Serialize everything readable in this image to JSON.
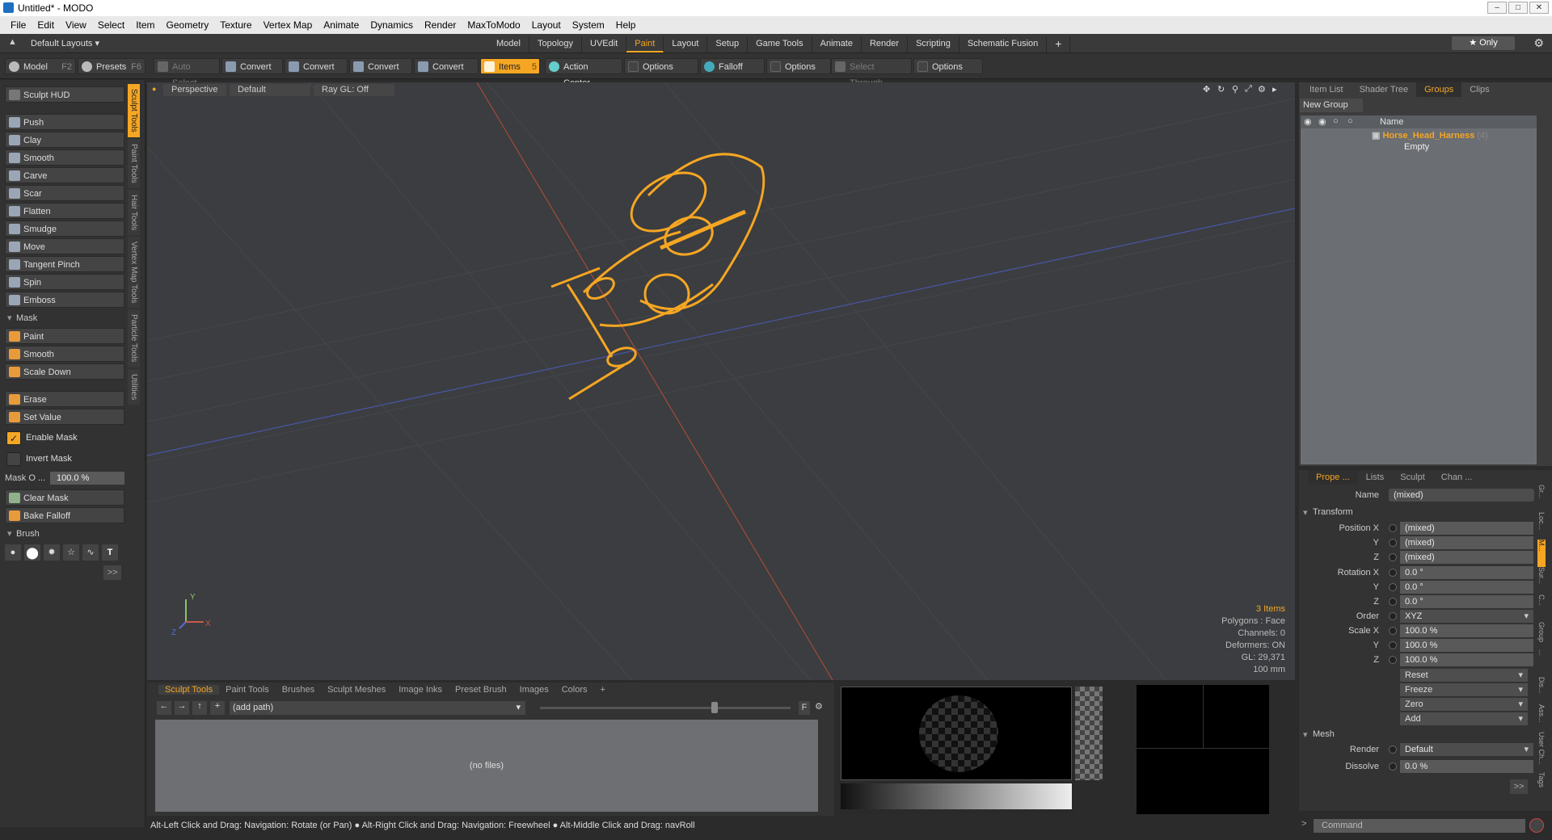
{
  "window": {
    "title": "Untitled* - MODO"
  },
  "menu": [
    "File",
    "Edit",
    "View",
    "Select",
    "Item",
    "Geometry",
    "Texture",
    "Vertex Map",
    "Animate",
    "Dynamics",
    "Render",
    "MaxToModo",
    "Layout",
    "System",
    "Help"
  ],
  "layout_bar": {
    "layouts_label": "Default Layouts ▾",
    "tabs": [
      "Model",
      "Topology",
      "UVEdit",
      "Paint",
      "Layout",
      "Setup",
      "Game Tools",
      "Animate",
      "Render",
      "Scripting",
      "Schematic Fusion"
    ],
    "active_tab": "Paint",
    "add": "+",
    "only_label": "★  Only"
  },
  "toolbar": {
    "model": "Model",
    "model_key": "F2",
    "presets": "Presets",
    "presets_key": "F6",
    "auto_select": "Auto Select",
    "convert": "Convert",
    "items": "Items",
    "items_key": "5",
    "action_center": "Action Center",
    "options": "Options",
    "falloff": "Falloff",
    "select_through": "Select Through"
  },
  "left_panel": {
    "sculpt_hud": "Sculpt HUD",
    "side_tabs": [
      "Sculpt Tools",
      "Paint Tools",
      "Hair Tools",
      "Vertex Map Tools",
      "Particle Tools",
      "Utilities"
    ],
    "tools": [
      "Push",
      "Clay",
      "Smooth",
      "Carve",
      "Scar",
      "Flatten",
      "Smudge",
      "Move",
      "Tangent Pinch",
      "Spin",
      "Emboss"
    ],
    "mask_section": "Mask",
    "mask_tools": [
      "Paint",
      "Smooth",
      "Scale Down"
    ],
    "erase": "Erase",
    "set_value": "Set Value",
    "enable_mask": "Enable Mask",
    "invert_mask": "Invert Mask",
    "mask_opacity_label": "Mask O ...",
    "mask_opacity_value": "100.0 %",
    "clear_mask": "Clear Mask",
    "bake_falloff": "Bake Falloff",
    "brush_section": "Brush",
    "more": ">>"
  },
  "viewport": {
    "view": "Perspective",
    "shading": "Default",
    "raygl": "Ray GL: Off",
    "info": {
      "items": "3 Items",
      "polygons": "Polygons : Face",
      "channels": "Channels: 0",
      "deformers": "Deformers: ON",
      "gl": "GL: 29,371",
      "scale": "100 mm"
    },
    "axis_x": "X",
    "axis_y": "Y",
    "axis_z": "Z",
    "accent": "#f5a623"
  },
  "right_top": {
    "tabs": [
      "Item List",
      "Shader Tree",
      "Groups",
      "Clips"
    ],
    "active_tab": "Groups",
    "new_group": "New Group",
    "col_name": "Name",
    "group_name": "Horse_Head_Harness",
    "group_count": "(4)",
    "group_sub": "Empty"
  },
  "properties": {
    "tabs": [
      "Prope ...",
      "Lists",
      "Sculpt",
      "Chan ..."
    ],
    "name_label": "Name",
    "name_value": "(mixed)",
    "transform": "Transform",
    "position_x_label": "Position X",
    "position_x": "(mixed)",
    "y_label": "Y",
    "z_label": "Z",
    "position_y": "(mixed)",
    "position_z": "(mixed)",
    "rotation_x_label": "Rotation X",
    "rotation_x": "0.0 °",
    "rotation_y": "0.0 °",
    "rotation_z": "0.0 °",
    "order_label": "Order",
    "order": "XYZ",
    "scale_x_label": "Scale X",
    "scale_x": "100.0 %",
    "scale_y": "100.0 %",
    "scale_z": "100.0 %",
    "reset": "Reset",
    "freeze": "Freeze",
    "zero": "Zero",
    "add": "Add",
    "mesh": "Mesh",
    "render_label": "Render",
    "render": "Default",
    "dissolve_label": "Dissolve",
    "dissolve": "0.0 %",
    "side_tabs": [
      "Gr...",
      "Loc...",
      "M...",
      "Sur...",
      "C...",
      "Group",
      "...",
      "Dis...",
      "Ass...",
      "User Ch...",
      "Tags"
    ],
    "more": ">>"
  },
  "bottom": {
    "tabs": [
      "Sculpt Tools",
      "Paint Tools",
      "Brushes",
      "Sculpt Meshes",
      "Image Inks",
      "Preset Brush",
      "Images",
      "Colors",
      "+"
    ],
    "path": "(add path)",
    "no_files": "(no files)",
    "f_label": "F"
  },
  "status": "Alt-Left Click and Drag: Navigation: Rotate (or Pan) ●  Alt-Right Click and Drag: Navigation: Freewheel ●  Alt-Middle Click and Drag: navRoll",
  "command_placeholder": "Command"
}
